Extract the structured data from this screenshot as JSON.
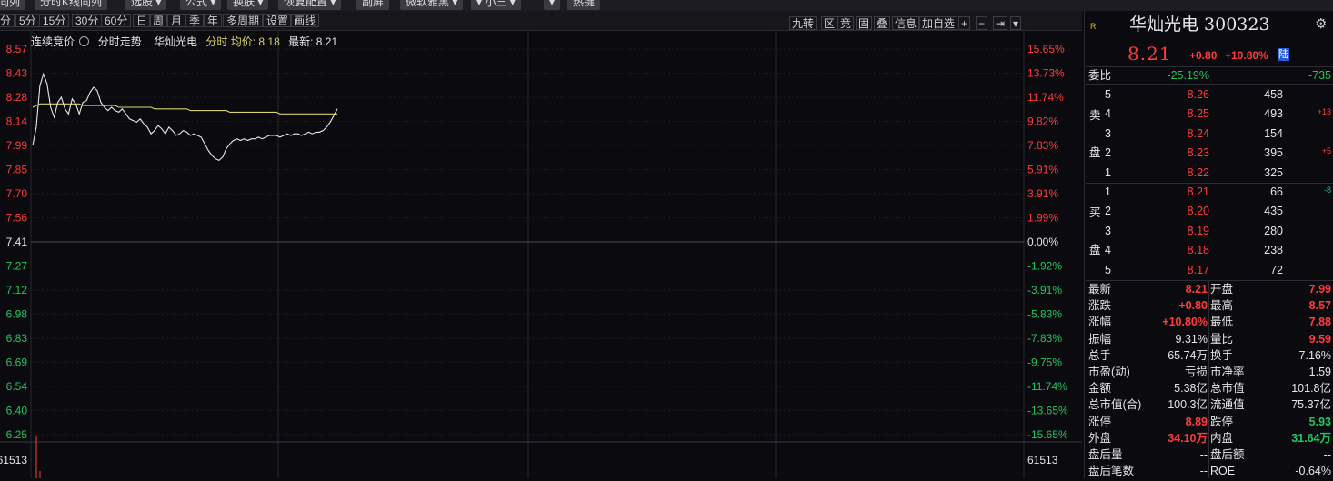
{
  "toolbar": {
    "items": [
      "同列",
      "分时K线同列",
      "选股 ▾",
      "公式 ▾",
      "换肤 ▾",
      "恢复配置 ▾",
      "副屏",
      "微软雅黑 ▾",
      "▾ 小三 ▾",
      "▾",
      "热键"
    ]
  },
  "periods": [
    "分",
    "5分",
    "15分",
    "30分",
    "60分",
    "日",
    "周",
    "月",
    "季",
    "年",
    "多周期",
    "设置",
    "画线"
  ],
  "chart_tools": [
    "九转",
    "区",
    "竞",
    "固",
    "叠",
    "信息",
    "加自选",
    "+",
    "−",
    "⇥",
    "▾"
  ],
  "chart_header": {
    "session": "连续竞价",
    "mode": "分时走势",
    "stock_name": "华灿光电",
    "avg_label": "分时 均价: 8.18",
    "latest_label": "最新: 8.21"
  },
  "y_axis_prices": [
    "8.57",
    "8.43",
    "8.28",
    "8.14",
    "7.99",
    "7.85",
    "7.70",
    "7.56",
    "7.41",
    "7.27",
    "7.12",
    "6.98",
    "6.83",
    "6.69",
    "6.54",
    "6.40",
    "6.25"
  ],
  "y_axis_pcts": [
    "15.65%",
    "13.73%",
    "11.74%",
    "9.82%",
    "7.83%",
    "5.91%",
    "3.91%",
    "1.99%",
    "0.00%",
    "-1.92%",
    "-3.91%",
    "-5.83%",
    "-7.83%",
    "-9.75%",
    "-11.74%",
    "-13.65%",
    "-15.65%"
  ],
  "volume_max_label": "61513",
  "chart_data": {
    "type": "line",
    "series": [
      {
        "values": [
          7.99,
          8.1,
          8.35,
          8.42,
          8.36,
          8.22,
          8.16,
          8.25,
          8.28,
          8.21,
          8.18,
          8.27,
          8.24,
          8.18,
          8.25,
          8.26,
          8.31,
          8.34,
          8.32,
          8.25,
          8.22,
          8.2,
          8.22,
          8.2,
          8.19,
          8.21,
          8.18,
          8.15,
          8.14,
          8.13,
          8.15,
          8.12,
          8.1,
          8.06,
          8.08,
          8.11,
          8.09,
          8.06,
          8.1,
          8.08,
          8.05,
          8.06,
          8.08,
          8.07,
          8.05,
          8.06,
          8.05,
          8.04,
          8.0,
          7.96,
          7.93,
          7.91,
          7.9,
          7.92,
          7.97,
          8.0,
          8.02,
          8.03,
          8.02,
          8.03,
          8.02,
          8.03,
          8.03,
          8.04,
          8.03,
          8.04,
          8.05,
          8.05,
          8.05,
          8.04,
          8.05,
          8.06,
          8.05,
          8.06,
          8.06,
          8.05,
          8.06,
          8.07,
          8.06,
          8.07,
          8.07,
          8.08,
          8.1,
          8.13,
          8.17,
          8.21
        ]
      },
      {
        "values": [
          8.22,
          8.23,
          8.24,
          8.24,
          8.24,
          8.24,
          8.24,
          8.24,
          8.24,
          8.24,
          8.24,
          8.24,
          8.24,
          8.24,
          8.23,
          8.23,
          8.23,
          8.23,
          8.23,
          8.23,
          8.23,
          8.23,
          8.23,
          8.23,
          8.22,
          8.22,
          8.22,
          8.22,
          8.22,
          8.22,
          8.22,
          8.22,
          8.22,
          8.22,
          8.21,
          8.21,
          8.21,
          8.21,
          8.21,
          8.21,
          8.21,
          8.21,
          8.21,
          8.21,
          8.2,
          8.2,
          8.2,
          8.2,
          8.2,
          8.2,
          8.2,
          8.2,
          8.2,
          8.2,
          8.2,
          8.19,
          8.19,
          8.19,
          8.19,
          8.19,
          8.19,
          8.19,
          8.19,
          8.19,
          8.19,
          8.19,
          8.19,
          8.19,
          8.19,
          8.18,
          8.18,
          8.18,
          8.18,
          8.18,
          8.18,
          8.18,
          8.18,
          8.18,
          8.18,
          8.18,
          8.18,
          8.18,
          8.18,
          8.18,
          8.18,
          8.18
        ]
      }
    ],
    "ylim": [
      6.25,
      8.57
    ],
    "grid": true,
    "colors": {
      "price": "#e8e8e8",
      "avg": "#d6d36c"
    }
  },
  "quote": {
    "market_tag": "R",
    "name_code": "华灿光电 300323",
    "price": "8.21",
    "change": "+0.80",
    "change_pct": "+10.80%",
    "badge": "陆"
  },
  "weibi": {
    "label": "委比",
    "pct": "-25.19%",
    "value": "-735"
  },
  "asks": [
    {
      "level": "5",
      "price": "8.26",
      "vol": "458",
      "delta": ""
    },
    {
      "level": "4",
      "price": "8.25",
      "vol": "493",
      "delta": "+13"
    },
    {
      "level": "3",
      "price": "8.24",
      "vol": "154",
      "delta": ""
    },
    {
      "level": "2",
      "price": "8.23",
      "vol": "395",
      "delta": "+5"
    },
    {
      "level": "1",
      "price": "8.22",
      "vol": "325",
      "delta": ""
    }
  ],
  "ask_label": [
    "卖",
    "盘"
  ],
  "bids": [
    {
      "level": "1",
      "price": "8.21",
      "vol": "66",
      "delta": "-8"
    },
    {
      "level": "2",
      "price": "8.20",
      "vol": "435",
      "delta": ""
    },
    {
      "level": "3",
      "price": "8.19",
      "vol": "280",
      "delta": ""
    },
    {
      "level": "4",
      "price": "8.18",
      "vol": "238",
      "delta": ""
    },
    {
      "level": "5",
      "price": "8.17",
      "vol": "72",
      "delta": ""
    }
  ],
  "bid_label": [
    "买",
    "盘"
  ],
  "stats": [
    {
      "l1": "最新",
      "v1": "8.21",
      "c1": "red",
      "l2": "开盘",
      "v2": "7.99",
      "c2": "red"
    },
    {
      "l1": "涨跌",
      "v1": "+0.80",
      "c1": "red",
      "l2": "最高",
      "v2": "8.57",
      "c2": "red"
    },
    {
      "l1": "涨幅",
      "v1": "+10.80%",
      "c1": "red",
      "l2": "最低",
      "v2": "7.88",
      "c2": "red"
    },
    {
      "l1": "振幅",
      "v1": "9.31%",
      "c1": "white",
      "l2": "量比",
      "v2": "9.59",
      "c2": "red"
    },
    {
      "l1": "总手",
      "v1": "65.74万",
      "c1": "white",
      "l2": "换手",
      "v2": "7.16%",
      "c2": "white"
    },
    {
      "l1": "市盈(动)",
      "v1": "亏损",
      "c1": "white",
      "l2": "市净率",
      "v2": "1.59",
      "c2": "white"
    },
    {
      "l1": "金额",
      "v1": "5.38亿",
      "c1": "white",
      "l2": "总市值",
      "v2": "101.8亿",
      "c2": "white"
    },
    {
      "l1": "总市值(合)",
      "v1": "100.3亿",
      "c1": "white",
      "l2": "流通值",
      "v2": "75.37亿",
      "c2": "white"
    },
    {
      "l1": "涨停",
      "v1": "8.89",
      "c1": "red",
      "l2": "跌停",
      "v2": "5.93",
      "c2": "green"
    },
    {
      "l1": "外盘",
      "v1": "34.10万",
      "c1": "red",
      "l2": "内盘",
      "v2": "31.64万",
      "c2": "green"
    },
    {
      "l1": "盘后量",
      "v1": "--",
      "c1": "white",
      "l2": "盘后额",
      "v2": "--",
      "c2": "white"
    },
    {
      "l1": "盘后笔数",
      "v1": "--",
      "c1": "white",
      "l2": "ROE",
      "v2": "-0.64%",
      "c2": "white"
    }
  ]
}
